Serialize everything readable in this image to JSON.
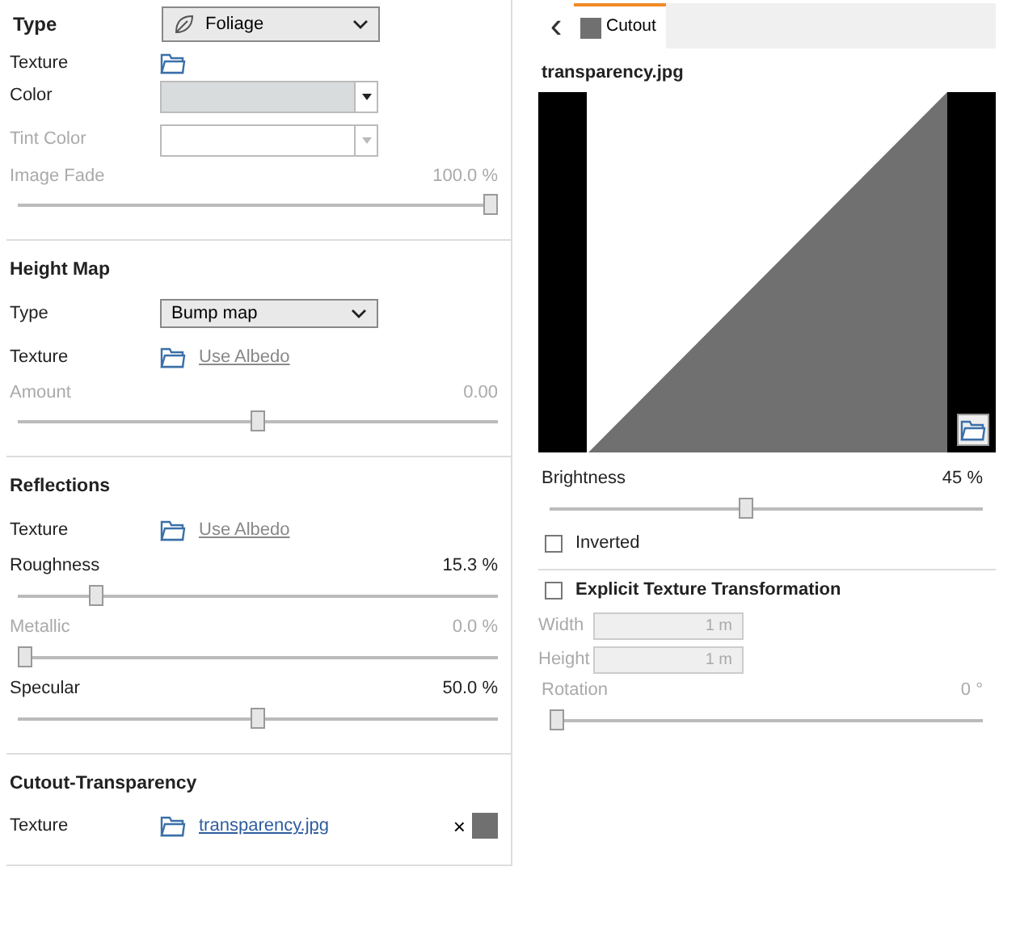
{
  "header": {
    "label": "Type",
    "value": "Foliage"
  },
  "sections": [
    {
      "rows": [
        {
          "kind": "texture",
          "label": "Texture",
          "cut": true
        },
        {
          "kind": "color",
          "label": "Color",
          "disabled": false
        },
        {
          "kind": "color",
          "label": "Tint Color",
          "disabled": true
        },
        {
          "kind": "slider",
          "label": "Image Fade",
          "reading": "100.0 %",
          "level": 1.0,
          "disabled": true
        }
      ]
    },
    {
      "title": "Height Map",
      "rows": [
        {
          "kind": "select",
          "label": "Type",
          "value": "Bump map"
        },
        {
          "kind": "texture",
          "label": "Texture",
          "file": "Use Albedo",
          "assigned": false
        },
        {
          "kind": "slider",
          "label": "Amount",
          "reading": "0.00",
          "level": 0.5,
          "disabled": true
        }
      ]
    },
    {
      "title": "Reflections",
      "rows": [
        {
          "kind": "texture",
          "label": "Texture",
          "file": "Use Albedo",
          "assigned": false
        },
        {
          "kind": "slider",
          "label": "Roughness",
          "reading": "15.3 %",
          "level": 0.153,
          "disabled": false
        },
        {
          "kind": "slider",
          "label": "Metallic",
          "reading": "0.0 %",
          "level": 0.0,
          "disabled": true
        },
        {
          "kind": "slider",
          "label": "Specular",
          "reading": "50.0 %",
          "level": 0.5,
          "disabled": false
        }
      ]
    },
    {
      "title": "Cutout-Transparency",
      "rows": [
        {
          "kind": "texture",
          "label": "Texture",
          "file": "transparency.jpg",
          "assigned": true,
          "clear": "×"
        }
      ]
    }
  ],
  "detail": {
    "back": "‹",
    "tabs": [
      {
        "label": "Cutout",
        "selected": true
      }
    ],
    "image_title": "transparency.jpg",
    "brightness": {
      "label": "Brightness",
      "reading": "45 %",
      "level": 0.45
    },
    "inverted": {
      "label": "Inverted",
      "checked": false
    },
    "explicit": {
      "label": "Explicit Texture Transformation",
      "checked": false
    },
    "fields": [
      {
        "label": "Width",
        "value": "1 m"
      },
      {
        "label": "Height",
        "value": "1 m"
      }
    ],
    "rotation": {
      "label": "Rotation",
      "reading": "0 °",
      "level": 0.0
    }
  }
}
